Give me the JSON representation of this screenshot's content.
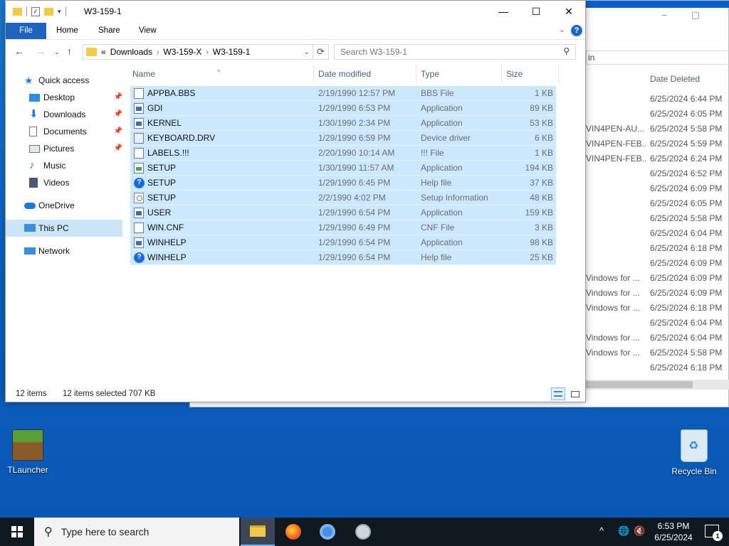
{
  "background_window": {
    "address_fragment": "in",
    "column_date": "Date Deleted",
    "names": [
      "",
      "",
      "VIN4PEN-AU...",
      "VIN4PEN-FEB...",
      "VIN4PEN-FEB...",
      "",
      "",
      "",
      "",
      "",
      "",
      "",
      "Vindows for ...",
      "Vindows for ...",
      "Vindows for ...",
      "",
      "Vindows for ...",
      "Vindows for ...",
      "",
      ""
    ],
    "dates": [
      "6/25/2024 6:44 PM",
      "6/25/2024 6:05 PM",
      "6/25/2024 5:58 PM",
      "6/25/2024 5:59 PM",
      "6/25/2024 6:24 PM",
      "6/25/2024 6:52 PM",
      "6/25/2024 6:09 PM",
      "6/25/2024 6:05 PM",
      "6/25/2024 5:58 PM",
      "6/25/2024 6:04 PM",
      "6/25/2024 6:18 PM",
      "6/25/2024 6:09 PM",
      "6/25/2024 6:09 PM",
      "6/25/2024 6:09 PM",
      "6/25/2024 6:18 PM",
      "6/25/2024 6:04 PM",
      "6/25/2024 6:04 PM",
      "6/25/2024 5:58 PM",
      "6/25/2024 6:18 PM"
    ]
  },
  "window": {
    "title": "W3-159-1",
    "ribbon": {
      "file": "File",
      "home": "Home",
      "share": "Share",
      "view": "View"
    },
    "address": {
      "prefix": "«",
      "parts": [
        "Downloads",
        "W3-159-X",
        "W3-159-1"
      ]
    },
    "search_placeholder": "Search W3-159-1",
    "nav": {
      "quick_access": "Quick access",
      "desktop": "Desktop",
      "downloads": "Downloads",
      "documents": "Documents",
      "pictures": "Pictures",
      "music": "Music",
      "videos": "Videos",
      "onedrive": "OneDrive",
      "this_pc": "This PC",
      "network": "Network"
    },
    "columns": {
      "name": "Name",
      "date": "Date modified",
      "type": "Type",
      "size": "Size"
    },
    "files": [
      {
        "icon": "doc",
        "name": "APPBA.BBS",
        "date": "2/19/1990 12:57 PM",
        "type": "BBS File",
        "size": "1 KB"
      },
      {
        "icon": "app",
        "name": "GDI",
        "date": "1/29/1990 6:53 PM",
        "type": "Application",
        "size": "89 KB"
      },
      {
        "icon": "app",
        "name": "KERNEL",
        "date": "1/30/1990 2:34 PM",
        "type": "Application",
        "size": "53 KB"
      },
      {
        "icon": "drv",
        "name": "KEYBOARD.DRV",
        "date": "1/29/1990 6:59 PM",
        "type": "Device driver",
        "size": "6 KB"
      },
      {
        "icon": "doc",
        "name": "LABELS.!!!",
        "date": "2/20/1990 10:14 AM",
        "type": "!!! File",
        "size": "1 KB"
      },
      {
        "icon": "setup",
        "name": "SETUP",
        "date": "1/30/1990 11:57 AM",
        "type": "Application",
        "size": "194 KB"
      },
      {
        "icon": "help",
        "name": "SETUP",
        "date": "1/29/1990 6:45 PM",
        "type": "Help file",
        "size": "37 KB"
      },
      {
        "icon": "gear",
        "name": "SETUP",
        "date": "2/2/1990 4:02 PM",
        "type": "Setup Information",
        "size": "48 KB"
      },
      {
        "icon": "app",
        "name": "USER",
        "date": "1/29/1990 6:54 PM",
        "type": "Application",
        "size": "159 KB"
      },
      {
        "icon": "doc",
        "name": "WIN.CNF",
        "date": "1/29/1990 6:49 PM",
        "type": "CNF File",
        "size": "3 KB"
      },
      {
        "icon": "app",
        "name": "WINHELP",
        "date": "1/29/1990 6:54 PM",
        "type": "Application",
        "size": "98 KB"
      },
      {
        "icon": "help",
        "name": "WINHELP",
        "date": "1/29/1990 6:54 PM",
        "type": "Help file",
        "size": "25 KB"
      }
    ],
    "status": {
      "count": "12 items",
      "selected": "12 items selected  707 KB"
    }
  },
  "desktop": {
    "tlauncher": "TLauncher",
    "recycle_bin": "Recycle Bin"
  },
  "taskbar": {
    "search_placeholder": "Type here to search",
    "time": "6:53 PM",
    "date": "6/25/2024",
    "notifications": "1"
  }
}
